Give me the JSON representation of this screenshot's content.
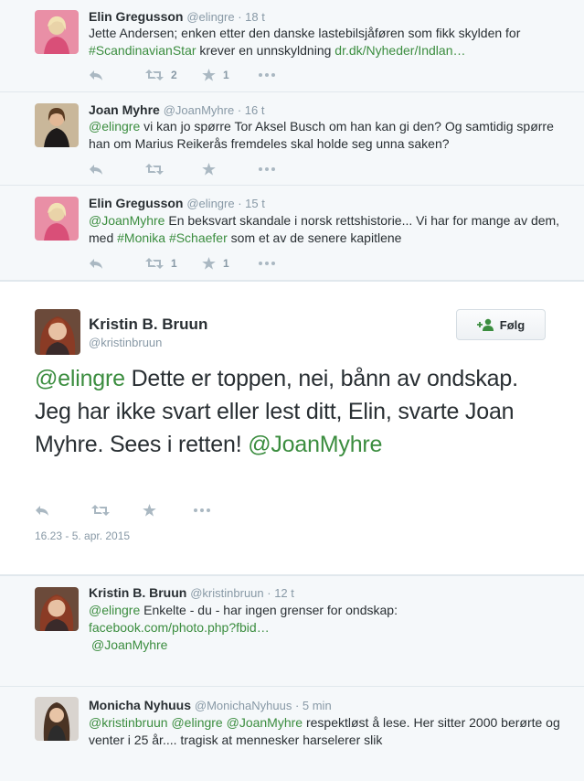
{
  "tweets_before": [
    {
      "name": "Elin Gregusson",
      "handle": "@elingre",
      "time": "18 t",
      "text_parts": [
        {
          "t": "Jette Andersen; enken etter den danske lastebilsjåføren som fikk skylden for ",
          "link": false
        },
        {
          "t": "#ScandinavianStar",
          "link": true
        },
        {
          "t": " krever en unnskyldning ",
          "link": false
        },
        {
          "t": "dr.dk/Nyheder/Indlan…",
          "link": true
        }
      ],
      "retweets": "2",
      "favorites": "1"
    },
    {
      "name": "Joan Myhre",
      "handle": "@JoanMyhre",
      "time": "16 t",
      "text_parts": [
        {
          "t": "@elingre",
          "link": true
        },
        {
          "t": " vi kan jo spørre Tor Aksel Busch om han kan gi den? Og samtidig spørre han om Marius Reikerås fremdeles skal holde seg unna saken?",
          "link": false
        }
      ],
      "retweets": "",
      "favorites": ""
    },
    {
      "name": "Elin Gregusson",
      "handle": "@elingre",
      "time": "15 t",
      "text_parts": [
        {
          "t": "@JoanMyhre",
          "link": true
        },
        {
          "t": " En beksvart skandale i norsk rettshistorie... Vi har for mange av dem, med ",
          "link": false
        },
        {
          "t": "#Monika",
          "link": true
        },
        {
          "t": " ",
          "link": false
        },
        {
          "t": "#Schaefer",
          "link": true
        },
        {
          "t": " som et av de senere kapitlene",
          "link": false
        }
      ],
      "retweets": "1",
      "favorites": "1"
    }
  ],
  "main_tweet": {
    "name": "Kristin B. Bruun",
    "handle": "@kristinbruun",
    "follow_label": "Følg",
    "text_parts": [
      {
        "t": "@elingre",
        "link": true
      },
      {
        "t": " Dette er toppen, nei, bånn av ondskap. Jeg har ikke svart eller lest ditt, Elin, svarte Joan Myhre. Sees i retten! ",
        "link": false
      },
      {
        "t": "@JoanMyhre",
        "link": true
      }
    ],
    "timestamp": "16.23 - 5. apr. 2015"
  },
  "tweets_after": [
    {
      "name": "Kristin B. Bruun",
      "handle": "@kristinbruun",
      "time": "12 t",
      "text_parts": [
        {
          "t": "@elingre",
          "link": true
        },
        {
          "t": " Enkelte - du - har ingen grenser for ondskap: ",
          "link": false
        },
        {
          "t": "facebook.com/photo.php?fbid…",
          "link": true
        },
        {
          "t": " @JoanMyhre",
          "link": true
        }
      ]
    },
    {
      "name": "Monicha Nyhuus",
      "handle": "@MonichaNyhuus",
      "time": "5 min",
      "text_parts": [
        {
          "t": "@kristinbruun",
          "link": true
        },
        {
          "t": " ",
          "link": false
        },
        {
          "t": "@elingre",
          "link": true
        },
        {
          "t": " ",
          "link": false
        },
        {
          "t": "@JoanMyhre",
          "link": true
        },
        {
          "t": " respektløst å lese. Her sitter 2000 berørte og venter i 25 år.... tragisk at mennesker harselerer slik",
          "link": false
        }
      ]
    }
  ],
  "colors": {
    "link": "#3b8d3f",
    "muted": "#8899a6",
    "icon": "#aab8c2"
  },
  "icons": [
    "reply-icon",
    "retweet-icon",
    "favorite-star-icon",
    "more-dots-icon",
    "add-user-icon"
  ]
}
